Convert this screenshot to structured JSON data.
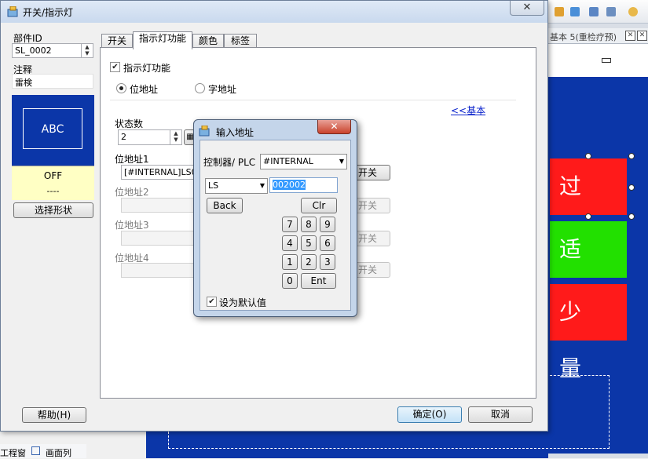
{
  "background": {
    "tab_label": "基本 5(重检疗预)",
    "lamps": [
      {
        "label": "过 量",
        "color": "#ff1a1a"
      },
      {
        "label": "适 量",
        "color": "#22e000"
      },
      {
        "label": "少 量",
        "color": "#ff1a1a"
      }
    ],
    "bottom_tabs": [
      "工程窗",
      "画面列"
    ]
  },
  "dialog": {
    "title": "开关/指示灯",
    "close_glyph": "✕",
    "part_id_label": "部件ID",
    "part_id_value": "SL_0002",
    "comment_label": "注释",
    "comment_value": "雷検",
    "preview": {
      "shape_text": "ABC",
      "state_text": "OFF",
      "state_sub": "----"
    },
    "select_shape_button": "选择形状",
    "help_button": "帮助(H)",
    "ok_button": "确定(O)",
    "cancel_button": "取消",
    "tabs": [
      {
        "label": "开关",
        "active": false
      },
      {
        "label": "指示灯功能",
        "active": true
      },
      {
        "label": "颜色",
        "active": false
      },
      {
        "label": "标签",
        "active": false
      }
    ],
    "indicator_function_label": "指示灯功能",
    "indicator_function_checked": true,
    "bit_address_label": "位地址",
    "word_address_label": "字地址",
    "basic_link": "<<基本",
    "state_count_label": "状态数",
    "state_count_value": "2",
    "bit_addresses": [
      {
        "label": "位地址1",
        "value": "[#INTERNAL]LS0",
        "switch_label": "开关"
      },
      {
        "label": "位地址2",
        "value": "",
        "switch_label": "开关"
      },
      {
        "label": "位地址3",
        "value": "",
        "switch_label": "开关"
      },
      {
        "label": "位地址4",
        "value": "",
        "switch_label": "开关"
      }
    ]
  },
  "popup": {
    "title": "输入地址",
    "close_glyph": "✕",
    "controller_label": "控制器/ PLC",
    "controller_value": "#INTERNAL",
    "device_value": "LS",
    "address_value": "002002",
    "back_button": "Back",
    "clr_button": "Clr",
    "keys": [
      "7",
      "8",
      "9",
      "4",
      "5",
      "6",
      "1",
      "2",
      "3",
      "0"
    ],
    "ent_button": "Ent",
    "default_label": "设为默认值",
    "default_checked": true
  }
}
